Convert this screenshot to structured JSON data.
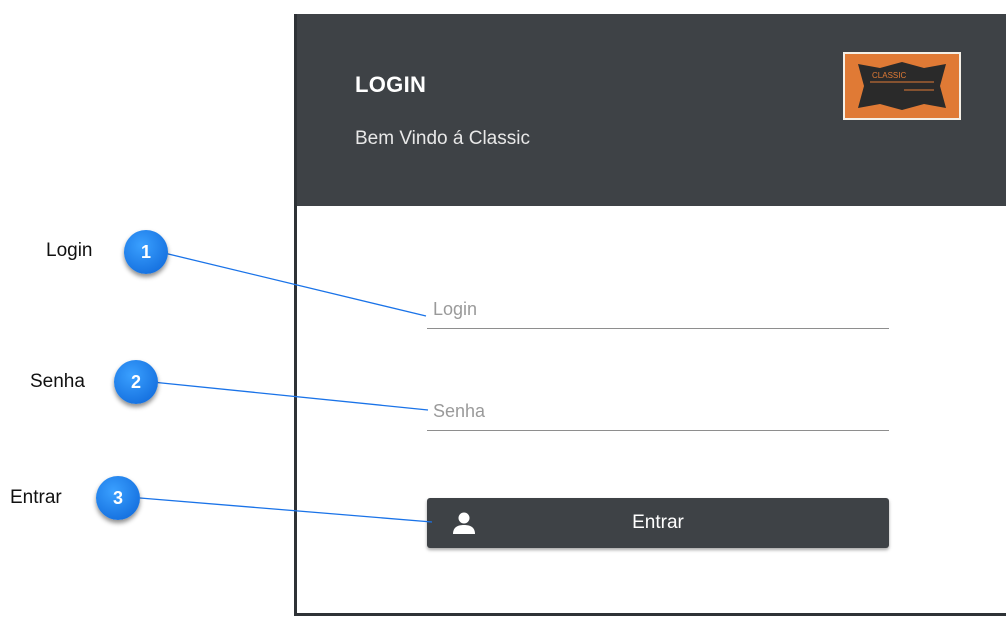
{
  "header": {
    "title": "LOGIN",
    "subtitle": "Bem Vindo á Classic",
    "logo_text": "CLASSIC"
  },
  "form": {
    "login_placeholder": "Login",
    "password_placeholder": "Senha",
    "submit_label": "Entrar"
  },
  "callouts": [
    {
      "number": "1",
      "label": "Login"
    },
    {
      "number": "2",
      "label": "Senha"
    },
    {
      "number": "3",
      "label": "Entrar"
    }
  ],
  "colors": {
    "header_bg": "#3e4246",
    "button_bg": "#3e4246",
    "logo_bg": "#e07a35",
    "badge": "#1a7ef0",
    "leader_line": "#1a73e8"
  },
  "icons": [
    "user-icon",
    "logo-image"
  ]
}
